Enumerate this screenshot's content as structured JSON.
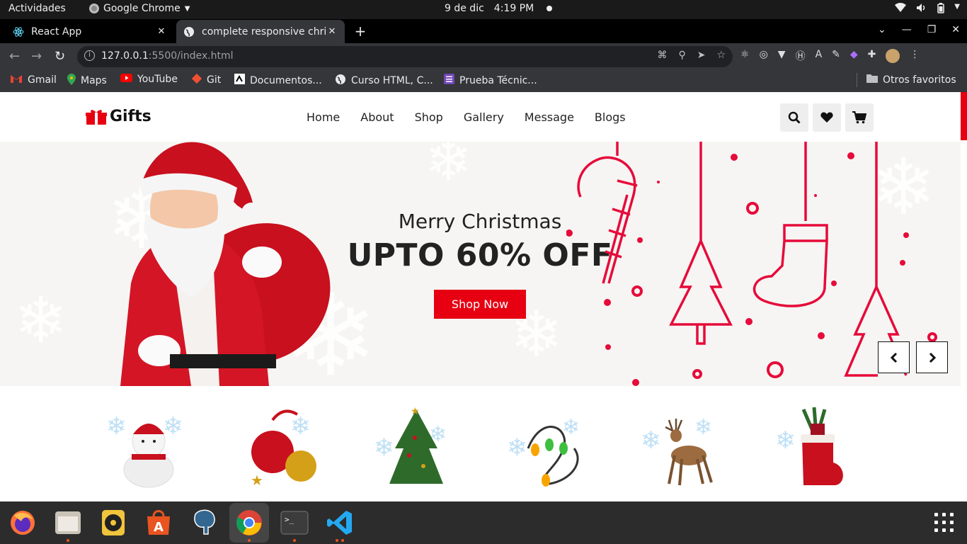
{
  "system_bar": {
    "activities": "Actividades",
    "app_name": "Google Chrome",
    "date": "9 de dic",
    "time": "4:19 PM"
  },
  "tabs": [
    {
      "title": "React App",
      "favicon": "react-icon"
    },
    {
      "title": "complete responsive chris",
      "favicon": "globe-icon",
      "active": true
    }
  ],
  "address_bar": {
    "host": "127.0.0.1",
    "path": ":5500/index.html"
  },
  "bookmarks": [
    {
      "label": "Gmail",
      "icon": "gmail-icon",
      "color": "#ea4335"
    },
    {
      "label": "Maps",
      "icon": "maps-icon",
      "color": "#34a853"
    },
    {
      "label": "YouTube",
      "icon": "youtube-icon",
      "color": "#ff0000"
    },
    {
      "label": "Git",
      "icon": "git-icon",
      "color": "#f05032"
    },
    {
      "label": "Documentos...",
      "icon": "docs-icon",
      "color": "#ffffff"
    },
    {
      "label": "Curso HTML, C...",
      "icon": "globe-icon",
      "color": "#ffffff"
    },
    {
      "label": "Prueba Técnic...",
      "icon": "forms-icon",
      "color": "#7248b9"
    }
  ],
  "other_bookmarks": "Otros favoritos",
  "site": {
    "logo": "Gifts",
    "nav": [
      "Home",
      "About",
      "Shop",
      "Gallery",
      "Message",
      "Blogs"
    ],
    "header_icons": [
      "search-icon",
      "heart-icon",
      "cart-icon"
    ],
    "hero": {
      "subtitle": "Merry Christmas",
      "title": "UPTO 60% OFF",
      "cta": "Shop Now"
    },
    "products": [
      "snowman",
      "ornaments",
      "christmas-tree",
      "lights",
      "reindeer",
      "christmas-boot"
    ],
    "accent_color": "#e60012"
  },
  "dock": [
    "firefox",
    "files",
    "rhythmbox",
    "software",
    "postgres",
    "chrome",
    "terminal",
    "vscode"
  ]
}
